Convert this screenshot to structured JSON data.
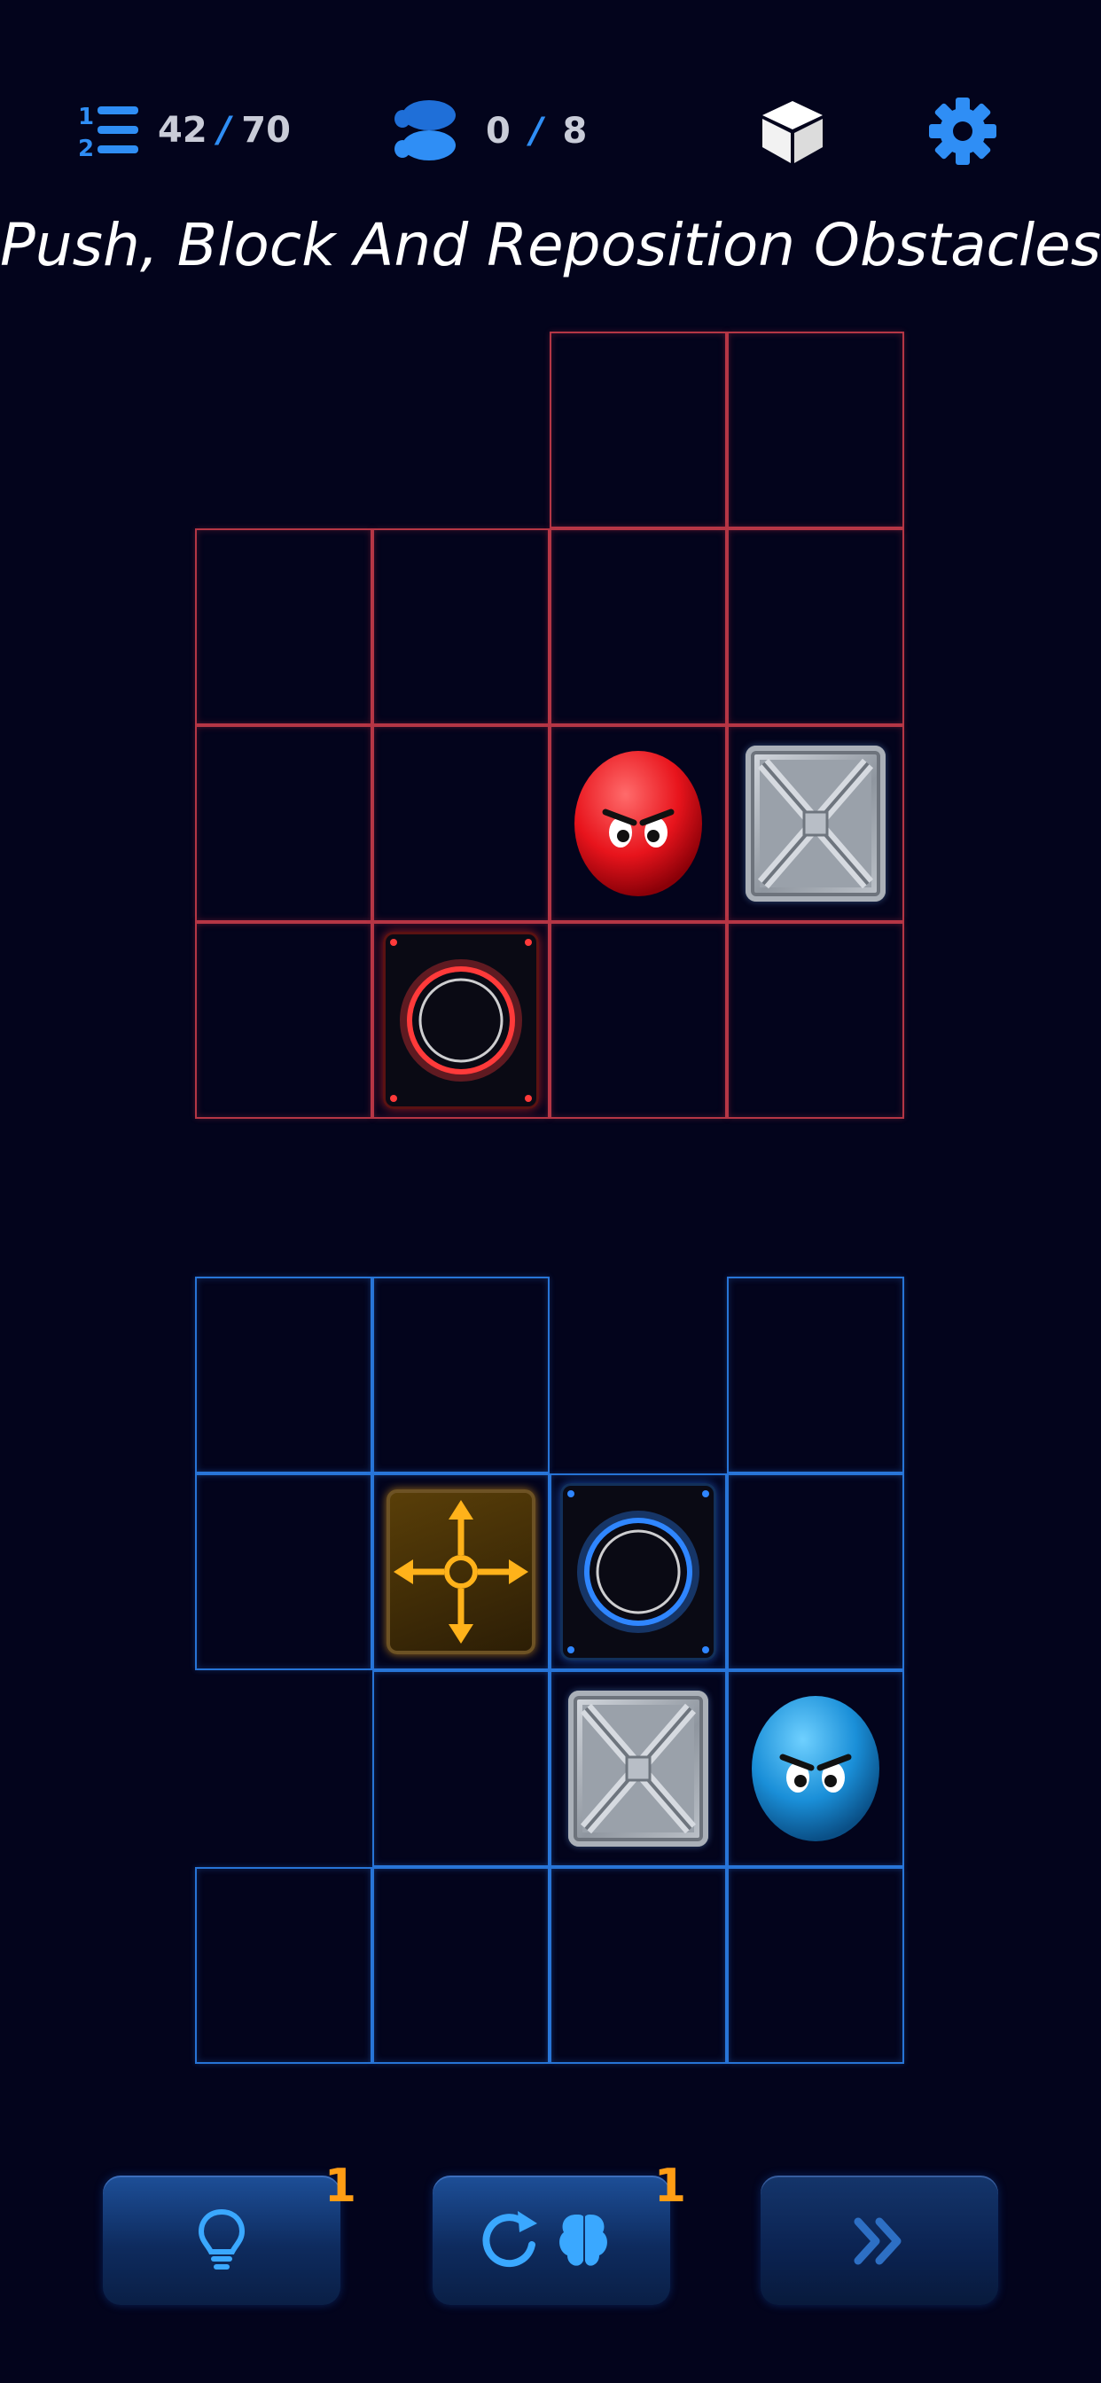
{
  "hud": {
    "level_current": "42",
    "level_sep": "/",
    "level_total": "70",
    "moves_current": "0",
    "moves_sep": "/",
    "moves_total": "8",
    "level_icon": "level-list-icon",
    "moves_icon": "footprints-icon",
    "cube_icon": "cube-icon",
    "settings_icon": "gear-icon"
  },
  "title": "Push, Block And Reposition Obstacles",
  "red_board": {
    "color": "#b43645",
    "rows": [
      [
        null,
        null,
        "cell",
        "cell"
      ],
      [
        "cell",
        "cell",
        "cell",
        "cell"
      ],
      [
        "cell",
        "cell",
        "red-ball",
        "crate"
      ],
      [
        "cell",
        "red-portal",
        "cell",
        "cell"
      ]
    ]
  },
  "blue_board": {
    "color": "#2774d6",
    "rows": [
      [
        "cell",
        "cell",
        null,
        "cell"
      ],
      [
        "cell",
        "move-tile",
        "blue-portal",
        "cell"
      ],
      [
        null,
        "cell",
        "crate",
        "blue-ball"
      ],
      [
        "cell",
        "cell",
        "cell",
        "cell"
      ]
    ]
  },
  "buttons": {
    "hint": {
      "icon": "lightbulb-icon",
      "badge": "1"
    },
    "reset": {
      "icon": "restart-brain-icon",
      "badge": "1"
    },
    "skip": {
      "icon": "double-chevron-right-icon"
    }
  },
  "colors": {
    "background": "#03041c",
    "accent_blue": "#2f8ef5",
    "badge_orange": "#ff9d14",
    "red_ball": "#e8141c",
    "blue_ball": "#1a8fd8"
  }
}
